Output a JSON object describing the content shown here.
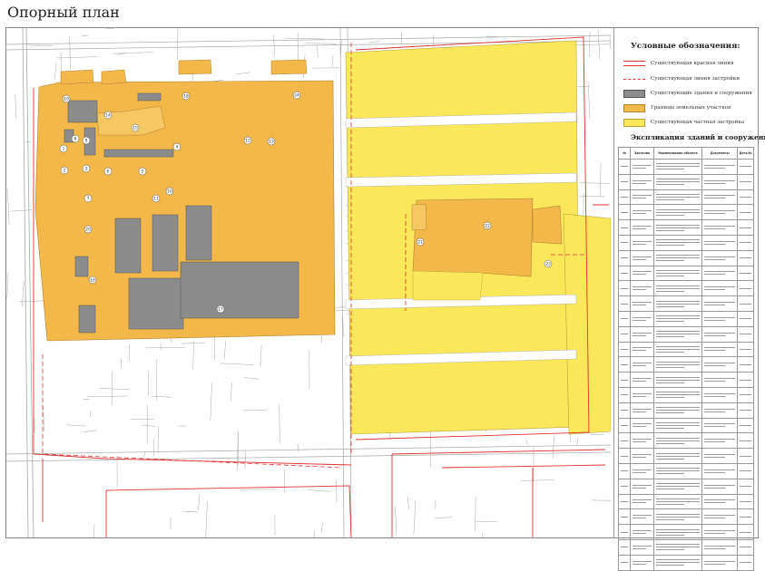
{
  "page": {
    "title": "Опорный план"
  },
  "legend": {
    "title": "Условные обозначения:",
    "items": [
      {
        "label": "Существующая красная линия",
        "style": "red-line",
        "color": "#e03030"
      },
      {
        "label": "Существующая линия застройки",
        "style": "red-dashed",
        "color": "#e03030"
      },
      {
        "label": "Существующие здания и сооружения",
        "style": "grey-fill",
        "color": "#8c8c8c"
      },
      {
        "label": "Границы земельных участков",
        "style": "orange-fill",
        "color": "#f2b84a"
      },
      {
        "label": "Существующая частная застройка",
        "style": "yellow-fill",
        "color": "#fbe85a"
      }
    ]
  },
  "explication": {
    "title": "Экспликация зданий и сооружений",
    "columns": [
      "№",
      "Заказчик",
      "Наименование объекта",
      "Документы",
      "Дата/№"
    ],
    "row_count": 27
  },
  "map": {
    "colors": {
      "private_yellow": "#fbe85a",
      "plot_orange": "#f2b84a",
      "building_grey": "#8c8c8c",
      "red_line": "#e03030",
      "base_line": "#a7a7a7"
    },
    "parcel_labels": [
      "1",
      "2",
      "3",
      "4",
      "5",
      "6",
      "7",
      "8",
      "9",
      "10",
      "11",
      "12",
      "13",
      "14",
      "15",
      "16",
      "17",
      "18",
      "19",
      "20",
      "21",
      "22",
      "23",
      "24"
    ]
  }
}
